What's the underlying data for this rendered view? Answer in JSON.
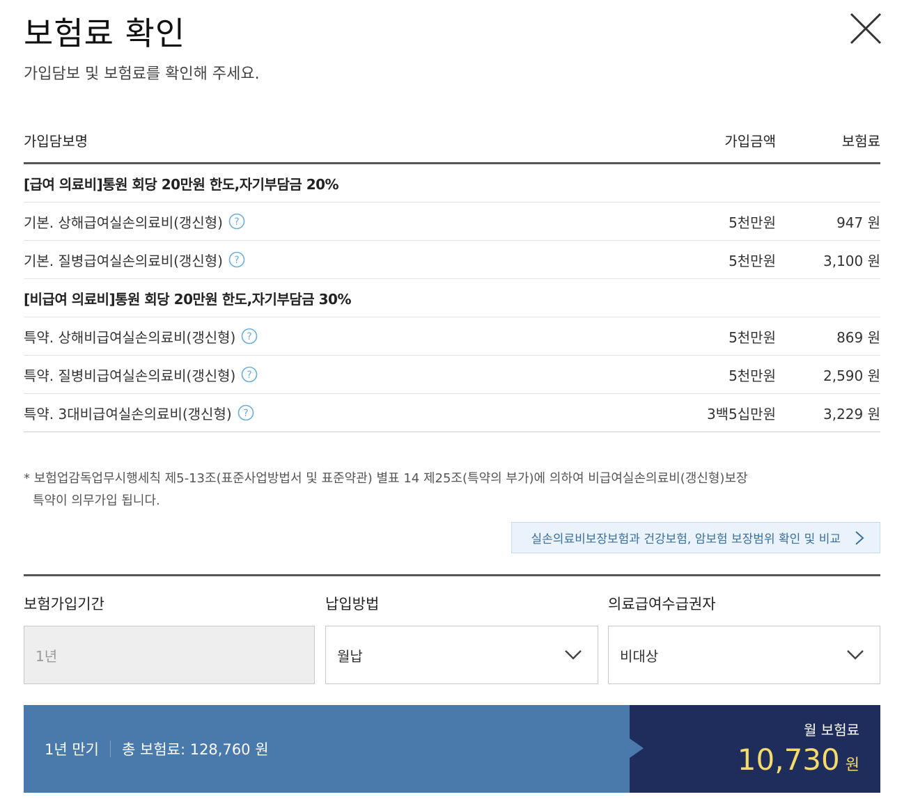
{
  "header": {
    "title": "보험료 확인",
    "subtitle": "가입담보 및 보험료를 확인해 주세요."
  },
  "table": {
    "columns": {
      "name": "가입담보명",
      "amount": "가입금액",
      "premium": "보험료"
    },
    "groups": [
      {
        "title": "[급여 의료비]통원 회당 20만원 한도,자기부담금 20%",
        "rows": [
          {
            "name": "기본. 상해급여실손의료비(갱신형)",
            "amount": "5천만원",
            "premium": "947 원"
          },
          {
            "name": "기본. 질병급여실손의료비(갱신형)",
            "amount": "5천만원",
            "premium": "3,100 원"
          }
        ]
      },
      {
        "title": "[비급여 의료비]통원 회당 20만원 한도,자기부담금 30%",
        "rows": [
          {
            "name": "특약. 상해비급여실손의료비(갱신형)",
            "amount": "5천만원",
            "premium": "869 원"
          },
          {
            "name": "특약. 질병비급여실손의료비(갱신형)",
            "amount": "5천만원",
            "premium": "2,590 원"
          },
          {
            "name": "특약. 3대비급여실손의료비(갱신형)",
            "amount": "3백5십만원",
            "premium": "3,229 원"
          }
        ]
      }
    ]
  },
  "notice": {
    "line1": "* 보험업감독업무시행세칙 제5-13조(표준사업방법서 및 표준약관) 별표 14 제25조(특약의 부가)에 의하여 비급여실손의료비(갱신형)보장",
    "line2": "특약이 의무가입 됩니다."
  },
  "compare_button": {
    "label": "실손의료비보장보험과 건강보험, 암보험 보장범위 확인 및 비교"
  },
  "fields": {
    "period": {
      "label": "보험가입기간",
      "value": "1년"
    },
    "payment": {
      "label": "납입방법",
      "value": "월납"
    },
    "medical_aid": {
      "label": "의료급여수급권자",
      "value": "비대상"
    }
  },
  "summary": {
    "term": "1년 만기",
    "total": "총 보험료: 128,760 원",
    "monthly_label": "월 보험료",
    "monthly_value": "10,730",
    "monthly_unit": "원"
  },
  "icons": {
    "close": "close-icon",
    "help": "question-circle-icon",
    "chevron_right": "chevron-right-icon",
    "chevron_down": "chevron-down-icon"
  },
  "colors": {
    "summary_left": "#4a79ab",
    "summary_right": "#1f2d5c",
    "monthly_value": "#f4db6a",
    "compare_bg": "#eaf3fb",
    "compare_text": "#3b6f99",
    "help_icon": "#6aaed6"
  }
}
